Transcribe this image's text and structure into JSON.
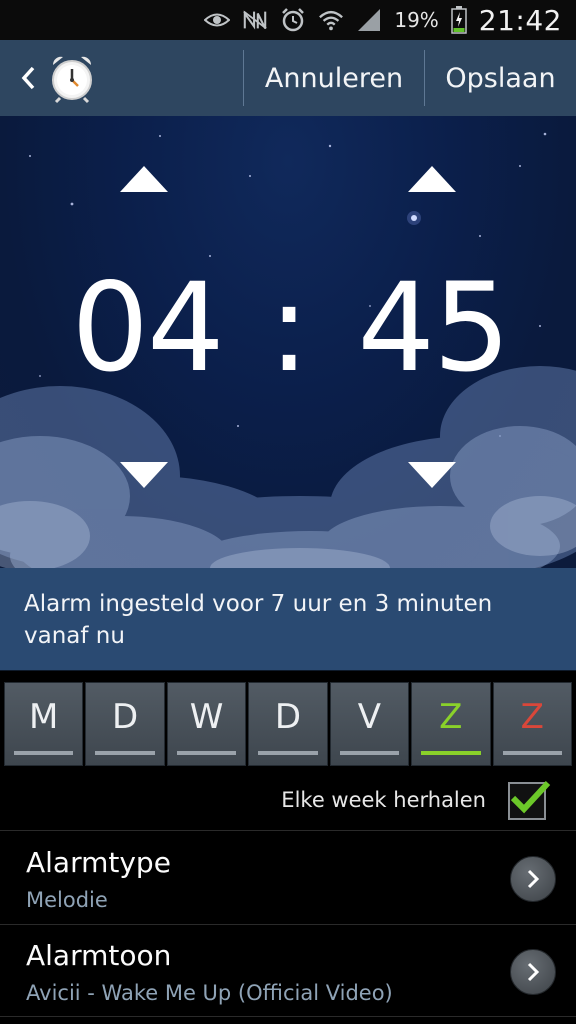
{
  "status_bar": {
    "icons": [
      "eye-icon",
      "nfc-icon",
      "alarm-icon",
      "wifi-icon",
      "signal-icon",
      "battery-charging-icon"
    ],
    "battery": "19%",
    "clock": "21:42"
  },
  "action_bar": {
    "back_icon": "chevron-left-icon",
    "app_icon": "alarm-clock-icon",
    "cancel_label": "Annuleren",
    "save_label": "Opslaan"
  },
  "time_picker": {
    "hours": "04",
    "separator": ":",
    "minutes": "45",
    "icons": [
      "triangle-up-icon",
      "triangle-down-icon"
    ]
  },
  "info": {
    "text": "Alarm ingesteld voor 7 uur en 3 minuten vanaf nu"
  },
  "days": [
    {
      "letter": "M",
      "active": false
    },
    {
      "letter": "D",
      "active": false
    },
    {
      "letter": "W",
      "active": false
    },
    {
      "letter": "D",
      "active": false
    },
    {
      "letter": "V",
      "active": false
    },
    {
      "letter": "Z",
      "active": true
    },
    {
      "letter": "Z",
      "active": false
    }
  ],
  "colors": {
    "action_bar": "#2e4660",
    "info_band": "#2a4a72",
    "day_active": "#8ad12a",
    "sunday": "#d9473a",
    "subtext": "#8fa3b6",
    "check": "#6cc829"
  },
  "repeat": {
    "label": "Elke week herhalen",
    "checked": true
  },
  "settings": [
    {
      "title": "Alarmtype",
      "subtitle": "Melodie",
      "icon": "chevron-right-icon"
    },
    {
      "title": "Alarmtoon",
      "subtitle": "Avicii - Wake Me Up (Official Video)",
      "icon": "chevron-right-icon"
    }
  ]
}
